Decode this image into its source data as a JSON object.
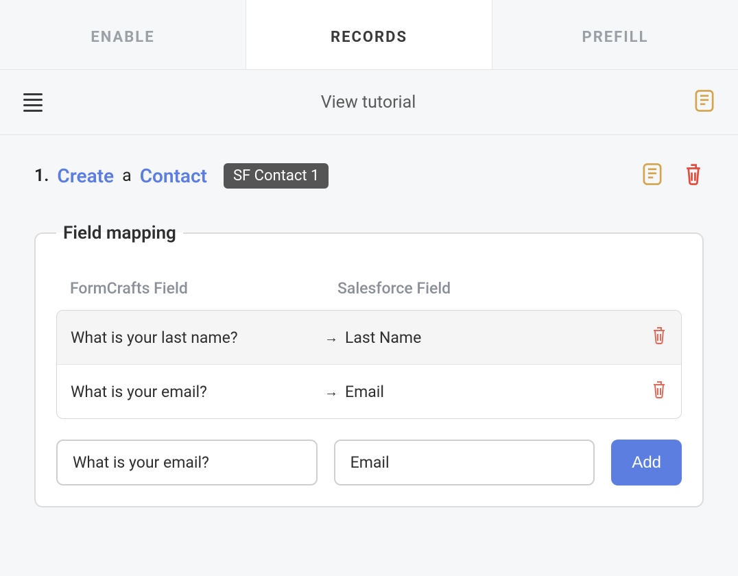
{
  "tabs": [
    {
      "label": "ENABLE",
      "active": false
    },
    {
      "label": "RECORDS",
      "active": true
    },
    {
      "label": "PREFILL",
      "active": false
    }
  ],
  "toolbar": {
    "title": "View tutorial"
  },
  "record": {
    "number": "1.",
    "action": "Create",
    "connector": "a",
    "object": "Contact",
    "badge": "SF Contact 1"
  },
  "fieldMapping": {
    "legend": "Field mapping",
    "headers": {
      "source": "FormCrafts Field",
      "target": "Salesforce Field"
    },
    "rows": [
      {
        "source": "What is your last name?",
        "target": "Last Name"
      },
      {
        "source": "What is your email?",
        "target": "Email"
      }
    ],
    "newRow": {
      "source": "What is your email?",
      "target": "Email"
    },
    "addLabel": "Add"
  },
  "colors": {
    "accent": "#5b7ee0",
    "warn": "#e06a5b",
    "gold": "#d4a44e"
  }
}
